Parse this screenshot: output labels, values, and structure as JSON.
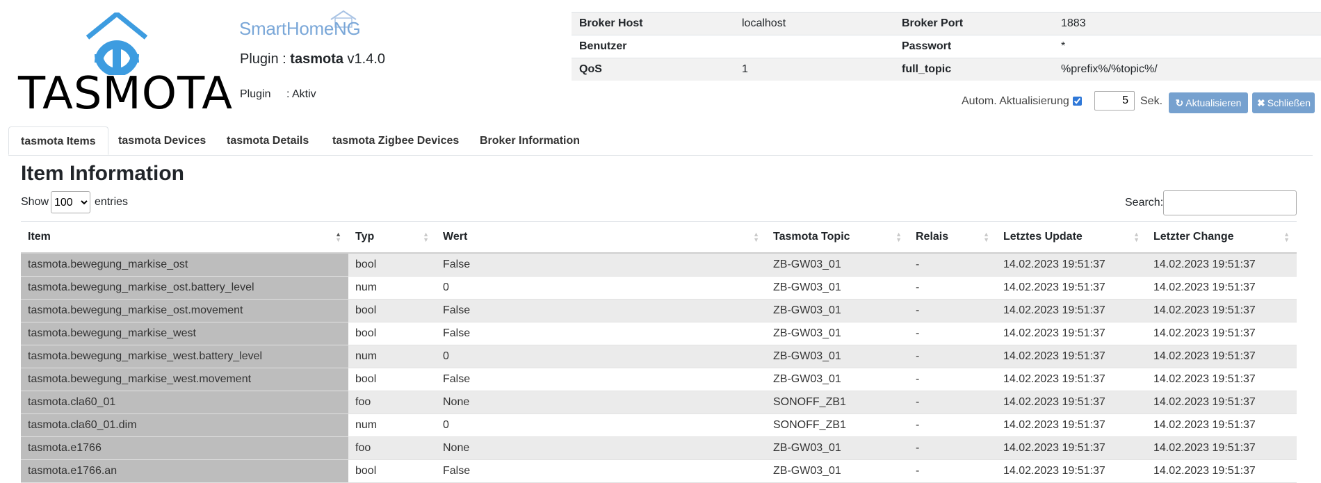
{
  "logos": {
    "tasmota_text": "TASMOTA",
    "shng_text_main": "SmartHome",
    "shng_text_accent": "NG",
    "shng_color": "#7aa7d8",
    "tasmota_icon_color": "#3d9ce0"
  },
  "plugin": {
    "prefix": "Plugin :",
    "name": "tasmota",
    "version": "v1.4.0",
    "status_label": "Plugin",
    "status_value": ": Aktiv"
  },
  "broker": {
    "rows": [
      {
        "k1": "Broker Host",
        "v1": "localhost",
        "k2": "Broker Port",
        "v2": "1883"
      },
      {
        "k1": "Benutzer",
        "v1": "",
        "k2": "Passwort",
        "v2": "*"
      },
      {
        "k1": "QoS",
        "v1": "1",
        "k2": "full_topic",
        "v2": "%prefix%/%topic%/"
      }
    ]
  },
  "controls": {
    "auto_refresh_label": "Autom. Aktualisierung",
    "auto_refresh_checked": true,
    "interval_value": "5",
    "interval_unit": "Sek.",
    "refresh_button": "Aktualisieren",
    "close_button": "Schließen"
  },
  "tabs": [
    {
      "label": "tasmota Items",
      "active": true
    },
    {
      "label": "tasmota Devices",
      "active": false
    },
    {
      "label": "tasmota Details",
      "active": false
    },
    {
      "label": "tasmota Zigbee Devices",
      "active": false
    },
    {
      "label": "Broker Information",
      "active": false
    }
  ],
  "section": {
    "heading": "Item Information",
    "show_label": "Show",
    "entries_selected": "100",
    "entries_label": "entries",
    "search_label": "Search:",
    "search_value": ""
  },
  "table": {
    "columns": [
      "Item",
      "Typ",
      "Wert",
      "Tasmota Topic",
      "Relais",
      "Letztes Update",
      "Letzter Change"
    ],
    "rows": [
      [
        "tasmota.bewegung_markise_ost",
        "bool",
        "False",
        "ZB-GW03_01",
        "-",
        "14.02.2023 19:51:37",
        "14.02.2023 19:51:37"
      ],
      [
        "tasmota.bewegung_markise_ost.battery_level",
        "num",
        "0",
        "ZB-GW03_01",
        "-",
        "14.02.2023 19:51:37",
        "14.02.2023 19:51:37"
      ],
      [
        "tasmota.bewegung_markise_ost.movement",
        "bool",
        "False",
        "ZB-GW03_01",
        "-",
        "14.02.2023 19:51:37",
        "14.02.2023 19:51:37"
      ],
      [
        "tasmota.bewegung_markise_west",
        "bool",
        "False",
        "ZB-GW03_01",
        "-",
        "14.02.2023 19:51:37",
        "14.02.2023 19:51:37"
      ],
      [
        "tasmota.bewegung_markise_west.battery_level",
        "num",
        "0",
        "ZB-GW03_01",
        "-",
        "14.02.2023 19:51:37",
        "14.02.2023 19:51:37"
      ],
      [
        "tasmota.bewegung_markise_west.movement",
        "bool",
        "False",
        "ZB-GW03_01",
        "-",
        "14.02.2023 19:51:37",
        "14.02.2023 19:51:37"
      ],
      [
        "tasmota.cla60_01",
        "foo",
        "None",
        "SONOFF_ZB1",
        "-",
        "14.02.2023 19:51:37",
        "14.02.2023 19:51:37"
      ],
      [
        "tasmota.cla60_01.dim",
        "num",
        "0",
        "SONOFF_ZB1",
        "-",
        "14.02.2023 19:51:37",
        "14.02.2023 19:51:37"
      ],
      [
        "tasmota.e1766",
        "foo",
        "None",
        "ZB-GW03_01",
        "-",
        "14.02.2023 19:51:37",
        "14.02.2023 19:51:37"
      ],
      [
        "tasmota.e1766.an",
        "bool",
        "False",
        "ZB-GW03_01",
        "-",
        "14.02.2023 19:51:37",
        "14.02.2023 19:51:37"
      ]
    ]
  }
}
